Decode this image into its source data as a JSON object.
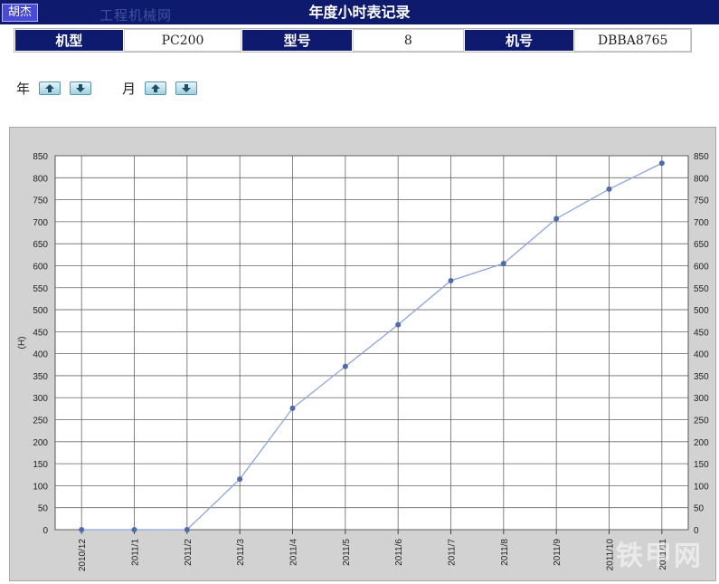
{
  "header": {
    "status_chip": "胡杰",
    "watermark": "工程机械网",
    "title": "年度小时表记录"
  },
  "info": {
    "model_type_label": "机型",
    "model_type_value": "PC200",
    "model_no_label": "型号",
    "model_no_value": "8",
    "machine_no_label": "机号",
    "machine_no_value": "DBBA8765"
  },
  "controls": {
    "year_label": "年",
    "month_label": "月"
  },
  "watermark_bottom": "铁甲网",
  "chart_data": {
    "type": "line",
    "categories": [
      "2010/12",
      "2011/1",
      "2011/2",
      "2011/3",
      "2011/4",
      "2011/5",
      "2011/6",
      "2011/7",
      "2011/8",
      "2011/9",
      "2011/10",
      "2011/11"
    ],
    "series": [
      {
        "values": [
          0,
          0,
          0,
          115,
          276,
          371,
          466,
          566,
          605,
          707,
          774,
          833
        ]
      }
    ],
    "ylabel": "(H)",
    "ylim": [
      0,
      850
    ],
    "yticks": [
      0,
      50,
      100,
      150,
      200,
      250,
      300,
      350,
      400,
      450,
      500,
      550,
      600,
      650,
      700,
      750,
      800,
      850
    ],
    "grid": true,
    "line_color": "#8aa6dc",
    "marker_color": "#4e6aa8",
    "secondary_y_axis": "right"
  }
}
